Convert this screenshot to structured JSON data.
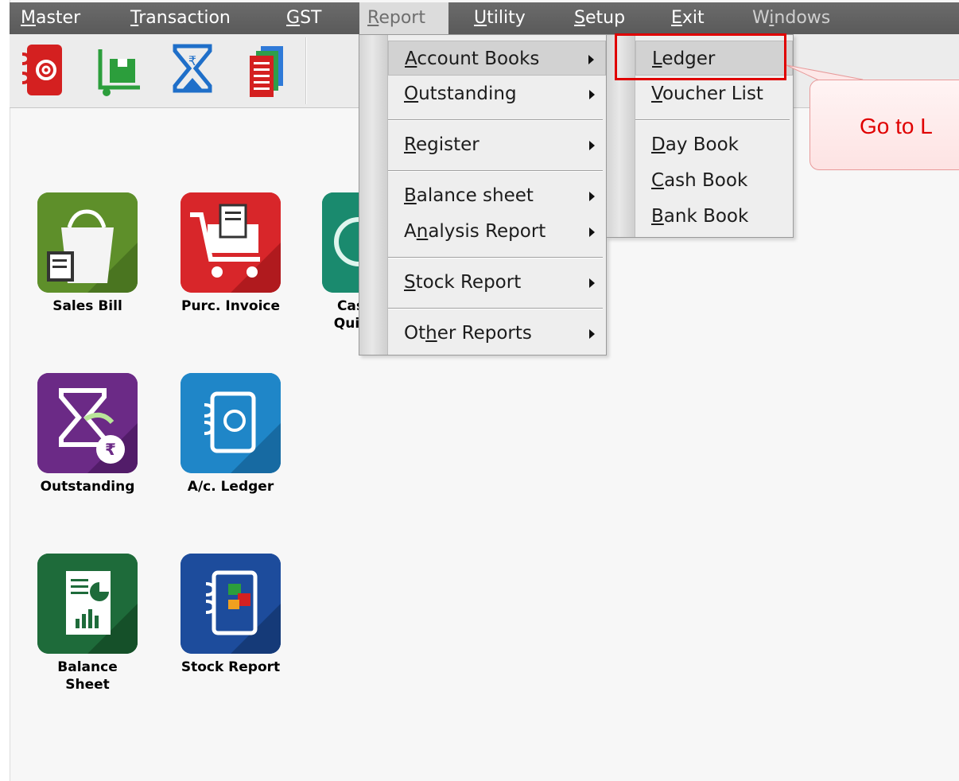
{
  "menubar": {
    "items": [
      {
        "label": "Master",
        "key": "M"
      },
      {
        "label": "Transaction",
        "key": "T"
      },
      {
        "label": "GST",
        "key": "G"
      },
      {
        "label": "Report",
        "key": "R"
      },
      {
        "label": "Utility",
        "key": "U"
      },
      {
        "label": "Setup",
        "key": "S"
      },
      {
        "label": "Exit",
        "key": "E"
      },
      {
        "label": "Windows",
        "key": "i"
      }
    ],
    "active": "Report"
  },
  "toolbar": {
    "icons": [
      "address-book-icon",
      "trolley-box-icon",
      "hourglass-rupee-icon",
      "stacked-reports-icon"
    ]
  },
  "desktop": {
    "tiles": [
      {
        "label": "Sales Bill",
        "icon": "shopping-bag-icon",
        "color": "#5e8f2a"
      },
      {
        "label": "Purc. Invoice",
        "icon": "cart-icon",
        "color": "#d8262a"
      },
      {
        "label": "Cas",
        "label2": "Quic",
        "icon": "cash-icon",
        "color": "#1a8a6e"
      },
      {
        "label": "Outstanding",
        "icon": "hourglass-rupee-icon",
        "color": "#6b2a86"
      },
      {
        "label": "A/c. Ledger",
        "icon": "address-book-icon",
        "color": "#1f86c8"
      },
      {
        "label": "Balance",
        "label2": "Sheet",
        "icon": "balance-sheet-icon",
        "color": "#1e6b3a"
      },
      {
        "label": "Stock Report",
        "icon": "stock-report-icon",
        "color": "#1d4c9c"
      }
    ]
  },
  "report_menu": {
    "items": [
      {
        "label": "Account Books",
        "has_submenu": true,
        "highlighted": true
      },
      {
        "label": "Outstanding",
        "has_submenu": true
      },
      {
        "label": "Register",
        "has_submenu": true
      },
      {
        "label": "Balance sheet",
        "has_submenu": true
      },
      {
        "label": "Analysis Report",
        "has_submenu": true
      },
      {
        "label": "Stock Report",
        "has_submenu": true
      },
      {
        "label": "Other Reports",
        "has_submenu": true
      }
    ]
  },
  "account_books_menu": {
    "items": [
      {
        "label": "Ledger",
        "highlighted": true
      },
      {
        "label": "Voucher List"
      },
      {
        "label": "Day Book"
      },
      {
        "label": "Cash Book"
      },
      {
        "label": "Bank Book"
      }
    ]
  },
  "callout": {
    "text": "Go to L"
  }
}
